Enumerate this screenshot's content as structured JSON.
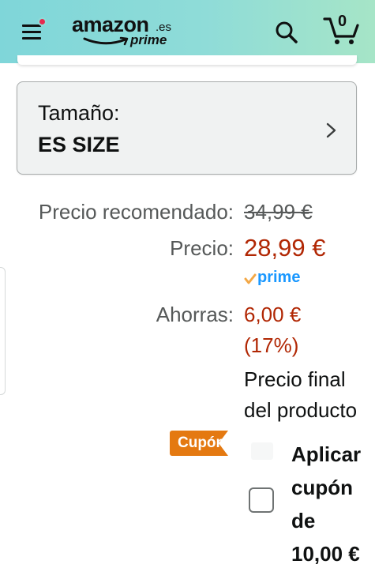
{
  "header": {
    "logo_word": "amazon",
    "logo_domain": ".es",
    "logo_sub": "prime",
    "cart_count": "0",
    "icons": [
      "menu-icon",
      "search-icon",
      "cart-icon"
    ],
    "notification_color": "#e7294f"
  },
  "size_selector": {
    "label": "Tamaño:",
    "value": "ES SIZE"
  },
  "pricing": {
    "list_price_label": "Precio recomendado:",
    "list_price": "34,99 €",
    "price_label": "Precio:",
    "price": "28,99 €",
    "prime_badge": "prime",
    "savings_label": "Ahorras:",
    "savings_amount": "6,00 €",
    "savings_percent": "(17%)",
    "final_price_line1": "Precio final",
    "final_price_line2": "del producto",
    "price_color": "#b12704"
  },
  "coupon": {
    "badge": "Cupón",
    "badge_color": "#e47911",
    "apply_lines": [
      "Aplicar",
      "cupón",
      "de",
      "10,00 €"
    ],
    "checked": false
  }
}
